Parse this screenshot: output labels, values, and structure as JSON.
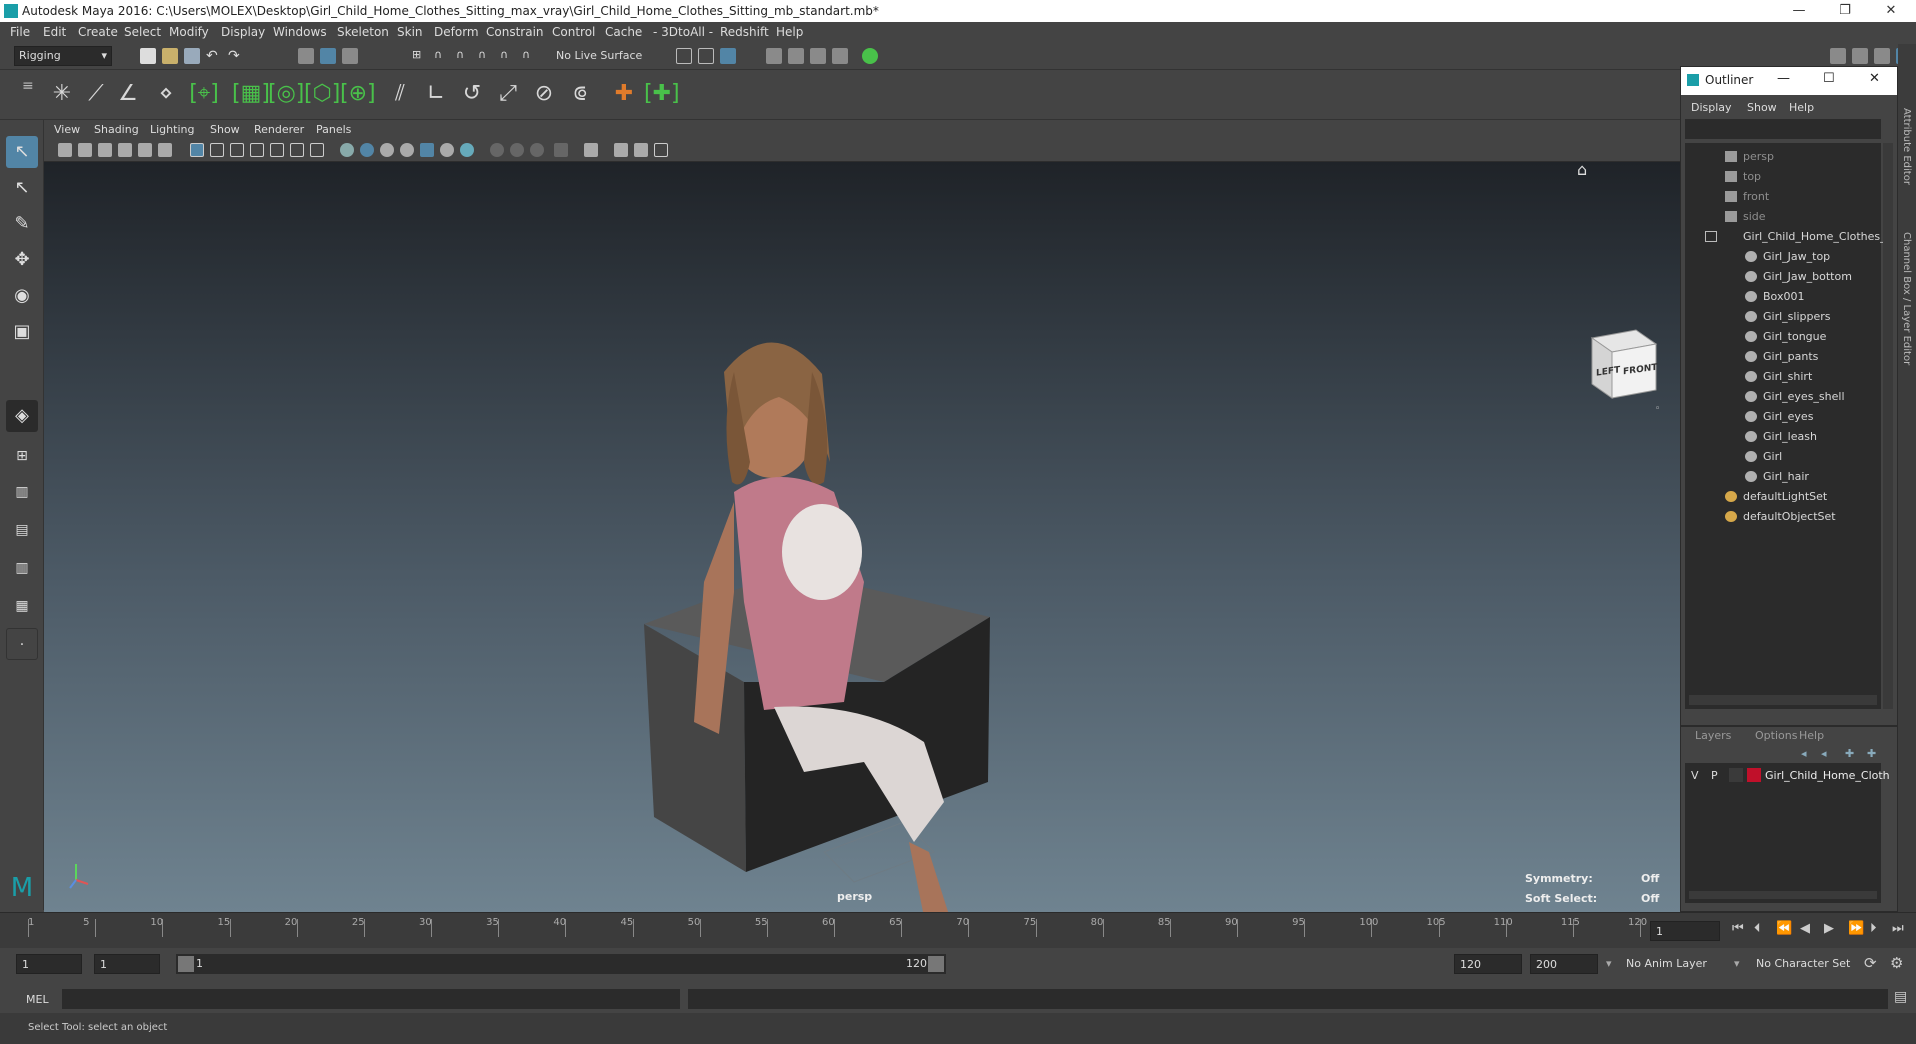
{
  "window": {
    "title": "Autodesk Maya 2016: C:\\Users\\MOLEX\\Desktop\\Girl_Child_Home_Clothes_Sitting_max_vray\\Girl_Child_Home_Clothes_Sitting_mb_standart.mb*",
    "controls": [
      "—",
      "❐",
      "✕"
    ]
  },
  "menubar": [
    "File",
    "Edit",
    "Create",
    "Select",
    "Modify",
    "Display",
    "Windows",
    "Skeleton",
    "Skin",
    "Deform",
    "Constrain",
    "Control",
    "Cache",
    "- 3DtoAll -",
    "Redshift",
    "Help"
  ],
  "statusline": {
    "mode": "Rigging",
    "live_surface": "No Live Surface"
  },
  "panel": {
    "menus": [
      "View",
      "Shading",
      "Lighting",
      "Show",
      "Renderer",
      "Panels"
    ],
    "camera_label": "persp",
    "viewcube": {
      "left": "LEFT",
      "front": "FRONT"
    },
    "hud": {
      "symmetry_label": "Symmetry:",
      "symmetry_value": "Off",
      "soft_select_label": "Soft Select:",
      "soft_select_value": "Off"
    }
  },
  "timeslider": {
    "labels": [
      "5",
      "10",
      "15",
      "20",
      "25",
      "30",
      "35",
      "40",
      "45",
      "50",
      "55",
      "60",
      "65",
      "70",
      "75",
      "80",
      "85",
      "90",
      "95",
      "100",
      "105",
      "110",
      "115",
      "120"
    ],
    "first_tick": "1",
    "current_frame": "1"
  },
  "range": {
    "start": "1",
    "playback_start": "1",
    "slider_start": "1",
    "slider_end": "120",
    "playback_end": "120",
    "end": "200",
    "anim_layer": "No Anim Layer",
    "character_set": "No Character Set"
  },
  "cmdline": {
    "lang": "MEL"
  },
  "helpline": {
    "text": "Select Tool: select an object"
  },
  "outliner": {
    "title": "Outliner",
    "menus": [
      "Display",
      "Show",
      "Help"
    ],
    "cameras": [
      "persp",
      "top",
      "front",
      "side"
    ],
    "group": "Girl_Child_Home_Clothes_S",
    "children": [
      "Girl_Jaw_top",
      "Girl_Jaw_bottom",
      "Box001",
      "Girl_slippers",
      "Girl_tongue",
      "Girl_pants",
      "Girl_shirt",
      "Girl_eyes_shell",
      "Girl_eyes",
      "Girl_leash",
      "Girl",
      "Girl_hair"
    ],
    "sets": [
      "defaultLightSet",
      "defaultObjectSet"
    ]
  },
  "layers": {
    "menus": [
      "Layers",
      "Options",
      "Help"
    ],
    "layer": {
      "v": "V",
      "p": "P",
      "name": "Girl_Child_Home_Cloth",
      "color": "#c0102a"
    }
  },
  "side_tabs": [
    "Attribute Editor",
    "Channel Box / Layer Editor"
  ],
  "colors": {
    "accent": "#1a9ea8",
    "shelf_green": "#49c14a",
    "selected": "#5285a6"
  }
}
